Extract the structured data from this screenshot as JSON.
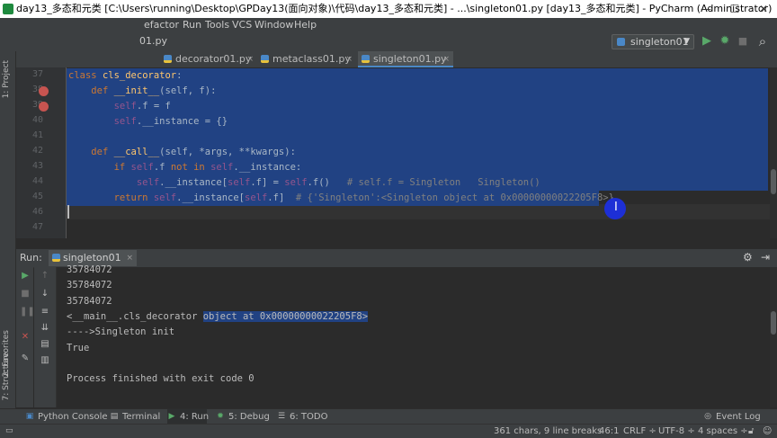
{
  "window": {
    "title": "day13_多态和元类 [C:\\Users\\running\\Desktop\\GPDay13(面向对象)\\代码\\day13_多态和元类] - ...\\singleton01.py [day13_多态和元类] - PyCharm (Administrator)",
    "minimize": "—",
    "maximize": "☐",
    "close": "✕"
  },
  "menu": [
    "efactor",
    "Run",
    "Tools",
    "VCS",
    "Window",
    "Help"
  ],
  "nav": {
    "breadcrumb": "01.py",
    "run_config": "singleton01",
    "run_icon": "▶",
    "debug_icon": "✹",
    "stop_icon": "■",
    "search_icon": "⌕"
  },
  "tabs": [
    {
      "label": "decorator01.py",
      "close": "×",
      "active": false
    },
    {
      "label": "metaclass01.py",
      "close": "×",
      "active": false
    },
    {
      "label": "singleton01.py",
      "close": "×",
      "active": true
    }
  ],
  "editor": {
    "line_numbers": [
      "37",
      "38",
      "39",
      "40",
      "41",
      "42",
      "43",
      "44",
      "45",
      "46",
      "47"
    ],
    "lines": [
      [
        {
          "t": "class ",
          "c": "kw"
        },
        {
          "t": "cls_decorator",
          "c": "fn"
        },
        {
          "t": ":",
          "c": ""
        }
      ],
      [
        {
          "t": "    ",
          "c": ""
        },
        {
          "t": "def ",
          "c": "kw"
        },
        {
          "t": "__init__",
          "c": "fn"
        },
        {
          "t": "(self, f):",
          "c": ""
        }
      ],
      [
        {
          "t": "        ",
          "c": ""
        },
        {
          "t": "self",
          "c": "self"
        },
        {
          "t": ".f = f",
          "c": ""
        }
      ],
      [
        {
          "t": "        ",
          "c": ""
        },
        {
          "t": "self",
          "c": "self"
        },
        {
          "t": ".__instance = {}",
          "c": ""
        }
      ],
      [
        {
          "t": "",
          "c": ""
        }
      ],
      [
        {
          "t": "    ",
          "c": ""
        },
        {
          "t": "def ",
          "c": "kw"
        },
        {
          "t": "__call__",
          "c": "fn"
        },
        {
          "t": "(self, *args, **kwargs):",
          "c": ""
        }
      ],
      [
        {
          "t": "        ",
          "c": ""
        },
        {
          "t": "if ",
          "c": "kw"
        },
        {
          "t": "self",
          "c": "self"
        },
        {
          "t": ".f ",
          "c": ""
        },
        {
          "t": "not in ",
          "c": "kw"
        },
        {
          "t": "self",
          "c": "self"
        },
        {
          "t": ".__instance:",
          "c": ""
        }
      ],
      [
        {
          "t": "            ",
          "c": ""
        },
        {
          "t": "self",
          "c": "self"
        },
        {
          "t": ".__instance[",
          "c": ""
        },
        {
          "t": "self",
          "c": "self"
        },
        {
          "t": ".f] = ",
          "c": ""
        },
        {
          "t": "self",
          "c": "self"
        },
        {
          "t": ".f()   ",
          "c": ""
        },
        {
          "t": "# self.f = Singleton   Singleton()",
          "c": "cmt"
        }
      ],
      [
        {
          "t": "        ",
          "c": ""
        },
        {
          "t": "return ",
          "c": "kw"
        },
        {
          "t": "self",
          "c": "self"
        },
        {
          "t": ".__instance[",
          "c": ""
        },
        {
          "t": "self",
          "c": "self"
        },
        {
          "t": ".f]  ",
          "c": ""
        },
        {
          "t": "# {'Singleton':<Singleton object at 0x00000000022205F8>}",
          "c": "cmt"
        }
      ],
      [
        {
          "t": "",
          "c": ""
        }
      ],
      [
        {
          "t": "",
          "c": ""
        }
      ]
    ]
  },
  "run_panel": {
    "label": "Run:",
    "tab": "singleton01",
    "tab_close": "×",
    "settings_icon": "⚙",
    "hide_icon": "⇥",
    "output": [
      "35784072",
      "35784072",
      "35784072",
      "<__main__.cls_decorator ",
      "---->Singleton init",
      "True",
      "",
      "Process finished with exit code 0"
    ],
    "output_selected": "object at 0x00000000022205F8>"
  },
  "left_strip": {
    "project": "1: Project",
    "favorites": "2: Favorites",
    "structure": "7: Structure"
  },
  "tool_tabs": [
    {
      "label": "Python Console",
      "icon": "▣"
    },
    {
      "label": "Terminal",
      "icon": "▤"
    },
    {
      "label": "4: Run",
      "icon": "▶"
    },
    {
      "label": "5: Debug",
      "icon": "✹"
    },
    {
      "label": "6: TODO",
      "icon": "☰"
    }
  ],
  "event_log": "Event Log",
  "status": {
    "chars": "361 chars, 9 line breaks",
    "position": "46:1",
    "line_sep": "CRLF ÷",
    "encoding": "UTF-8 ÷",
    "indent": "4 spaces ÷"
  }
}
